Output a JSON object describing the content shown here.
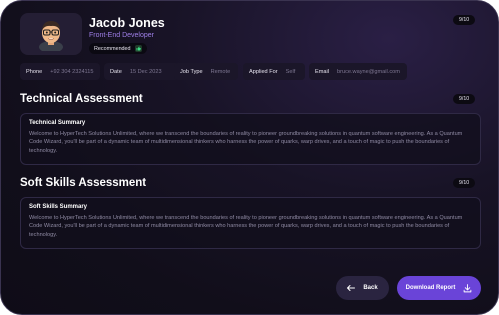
{
  "profile": {
    "name": "Jacob Jones",
    "role": "Front-End Developer",
    "badge": "Recommended",
    "score": "9/10"
  },
  "info": [
    {
      "label": "Phone",
      "value": "+92 304 2324115"
    },
    {
      "label": "Date",
      "value": "15 Dec 2023"
    },
    {
      "label": "Job Type",
      "value": "Remote"
    },
    {
      "label": "Applied For",
      "value": "Self"
    },
    {
      "label": "Email",
      "value": "bruce.wayne@gmail.com"
    }
  ],
  "sections": [
    {
      "title": "Technical Assessment",
      "score": "9/10",
      "card_title": "Technical Summary",
      "card_body": "Welcome to HyperTech Solutions Unlimited, where we transcend the boundaries of reality to pioneer groundbreaking solutions in quantum software engineering. As a Quantum Code Wizard, you'll be part of a dynamic team of multidimensional thinkers who harness the power of quarks, warp drives, and a touch of magic to push the boundaries of technology."
    },
    {
      "title": "Soft Skills Assessment",
      "score": "9/10",
      "card_title": "Soft Skills Summary",
      "card_body": "Welcome to HyperTech Solutions Unlimited, where we transcend the boundaries of reality to pioneer groundbreaking solutions in quantum software engineering. As a Quantum Code Wizard, you'll be part of a dynamic team of multidimensional thinkers who harness the power of quarks, warp drives, and a touch of magic to push the boundaries of technology."
    }
  ],
  "actions": {
    "back": "Back",
    "download": "Download Report"
  },
  "colors": {
    "accent": "#6a44d8",
    "role_text": "#9f7fe8",
    "background": "#110e1a"
  },
  "icons": {
    "avatar": "memoji-avatar",
    "badge": "thumbs-up-icon",
    "back": "arrow-left-icon",
    "download": "download-icon"
  }
}
